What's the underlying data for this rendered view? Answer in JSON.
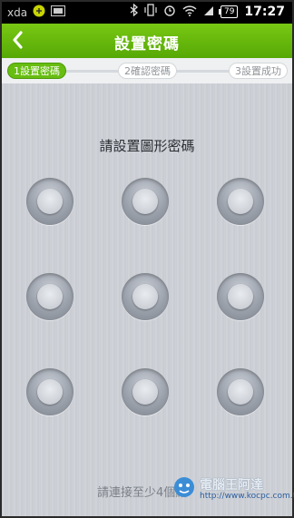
{
  "status_bar": {
    "carrier_text": "xda",
    "battery_level": "79",
    "clock": "17:27"
  },
  "header": {
    "back_glyph": "〈",
    "title": "設置密碼"
  },
  "steps": [
    {
      "label": "1設置密碼",
      "state": "active"
    },
    {
      "label": "2確認密碼",
      "state": "inactive"
    },
    {
      "label": "3設置成功",
      "state": "inactive"
    }
  ],
  "pattern": {
    "prompt": "請設置圖形密碼",
    "grid_size": "3x3",
    "hint": "請連接至少4個點"
  },
  "watermark": {
    "title": "電腦王阿達",
    "url": "http://www.kocpc.com.tw"
  },
  "colors": {
    "header_green": "#5fb30a",
    "active_step": "#67bd10",
    "background": "#cfd2d7"
  }
}
